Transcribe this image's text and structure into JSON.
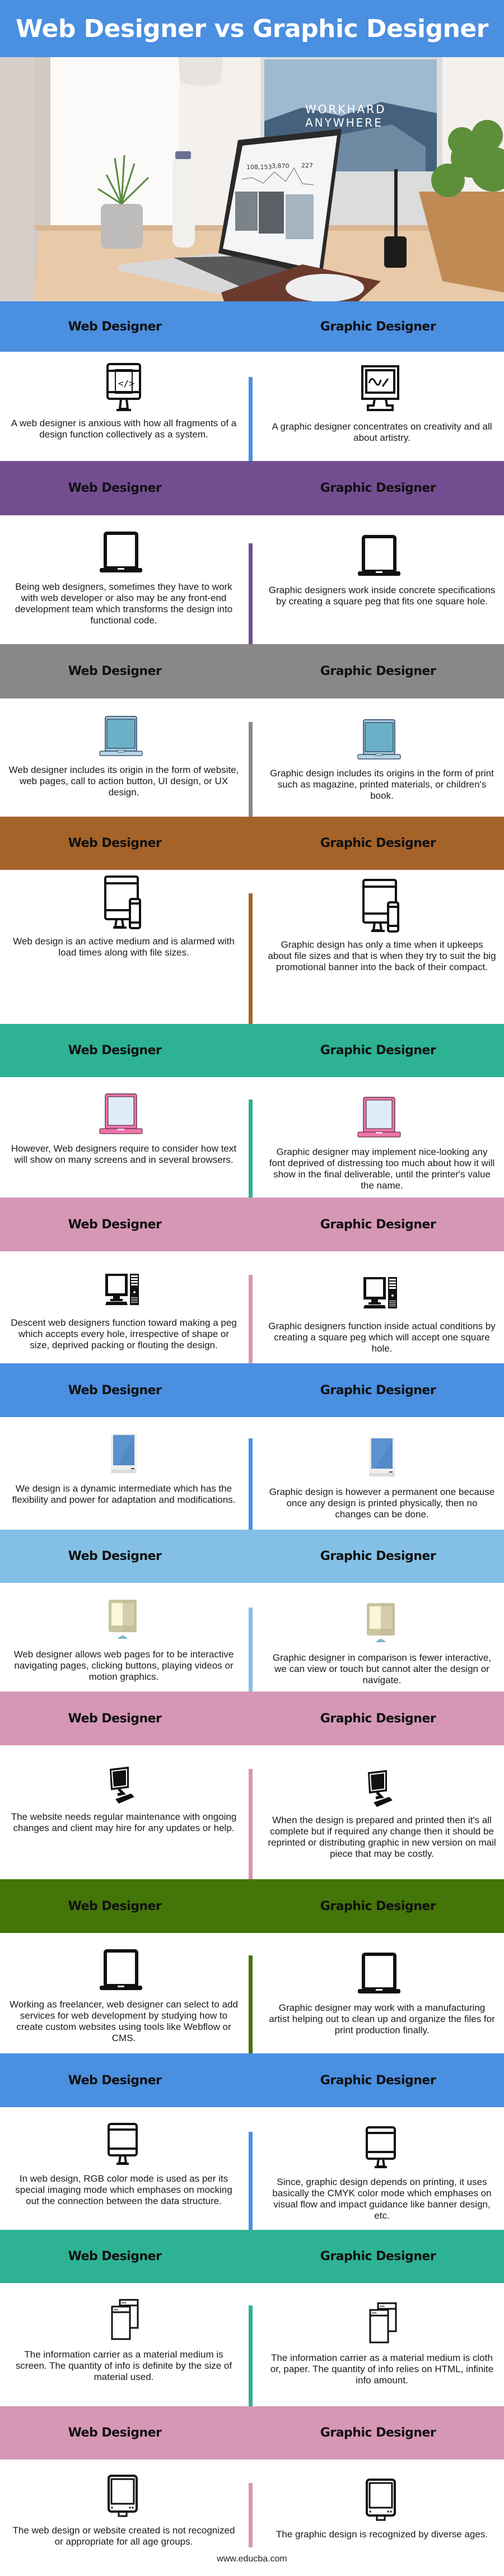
{
  "title": "Web Designer vs Graphic Designer",
  "hero": {
    "monitor_headline_line1": "WORKHARD",
    "monitor_headline_line2": "ANYWHERE",
    "laptop_stats": [
      "108,153",
      "3,870",
      "227"
    ]
  },
  "column_labels": {
    "left": "Web Designer",
    "right": "Graphic Designer"
  },
  "sections": [
    {
      "color": "#4a8fe0",
      "icon": "code-monitor-icon",
      "icon_right": "drawing-monitor-icon",
      "left": "A web designer is anxious with how all fragments of a design function collectively as a system.",
      "right": "A graphic designer concentrates on creativity and all about artistry."
    },
    {
      "color": "#724e91",
      "icon": "laptop-icon",
      "icon_right": "laptop-icon",
      "left": "Being web designers, sometimes they have to work with web developer or also may be any front-end development team which transforms the design into functional code.",
      "right": "Graphic designers work inside concrete specifications by creating a square peg that fits one square hole."
    },
    {
      "color": "#888888",
      "icon": "blue-laptop-icon",
      "icon_right": "blue-laptop-icon",
      "left": "Web designer includes its origin in the form of website, web pages, call to action button, UI design, or UX design.",
      "right": "Graphic design includes its origins in the form of print such as magazine, printed materials, or children's book."
    },
    {
      "color": "#a5632a",
      "icon": "responsive-devices-icon",
      "icon_right": "responsive-devices-icon",
      "left": "Web design is an active medium and is alarmed with load times along with file sizes.",
      "right": "Graphic design has only a time when it upkeeps about file sizes and that is when they try to suit the big promotional banner into the back of their compact."
    },
    {
      "color": "#2db294",
      "icon": "pink-laptop-icon",
      "icon_right": "pink-laptop-icon",
      "left": "However, Web designers require to consider how text will show on many screens and in several browsers.",
      "right": "Graphic designer may implement nice-looking any font deprived of distressing too much about how it will show in the final deliverable, until the printer's value the name."
    },
    {
      "color": "#d597b5",
      "icon": "desktop-pc-icon",
      "icon_right": "desktop-pc-icon",
      "left": "Descent web designers function toward making a peg which accepts every hole, irrespective of shape or size, deprived packing or flouting the design.",
      "right": "Graphic designers function inside actual conditions by creating a square peg which will accept one square hole."
    },
    {
      "color": "#4a8fe0",
      "icon": "tablet-icon",
      "icon_right": "tablet-icon",
      "left": "We design is a dynamic intermediate which has the flexibility and power for adaptation and modifications.",
      "right": "Graphic design is however a permanent one because once any design is printed physically, then no changes can be done."
    },
    {
      "color": "#84c0e6",
      "icon": "flat-monitor-icon",
      "icon_right": "flat-monitor-icon",
      "left": "Web designer allows web pages for to be interactive navigating pages, clicking buttons, playing videos or motion graphics.",
      "right": "Graphic designer in comparison is fewer interactive, we can view or touch but cannot alter the design or navigate."
    },
    {
      "color": "#d597b5",
      "icon": "computer-keyboard-icon",
      "icon_right": "computer-keyboard-icon",
      "left": "The website needs regular maintenance with ongoing changes and client may hire for any updates or help.",
      "right": "When the design is prepared and printed then it's all complete but if required any change then it should be reprinted or distributing graphic in new version on mail piece that may be costly."
    },
    {
      "color": "#447508",
      "icon": "laptop-icon",
      "icon_right": "laptop-icon",
      "left": "Working as freelancer, web designer can select to add services for web development by studying how to create custom websites using tools like Webflow or CMS.",
      "right": "Graphic designer may work with a manufacturing artist helping out to clean up and organize the files for print production finally."
    },
    {
      "color": "#4a8fe0",
      "icon": "monitor-outline-icon",
      "icon_right": "monitor-outline-icon",
      "left": "In web design, RGB color mode is used as per its special imaging mode which emphases on mocking out the connection between the data structure.",
      "right": "Since, graphic design depends on printing, it uses basically the CMYK color mode which emphases on visual flow and impact guidance like banner design, etc."
    },
    {
      "color": "#2db294",
      "icon": "browser-windows-icon",
      "icon_right": "browser-windows-icon",
      "left": "The information carrier as a material medium is screen. The quantity of info is definite by the size of material used.",
      "right": "The information carrier as a material medium is cloth or, paper. The quantity of info relies on HTML, infinite info amount."
    },
    {
      "color": "#d597b5",
      "icon": "crt-monitor-icon",
      "icon_right": "crt-monitor-icon",
      "left": "The web design or website created is not recognized or appropriate for all age groups.",
      "right": "The graphic design is recognized by diverse ages."
    }
  ],
  "footer": {
    "site": "www.educba.com"
  }
}
